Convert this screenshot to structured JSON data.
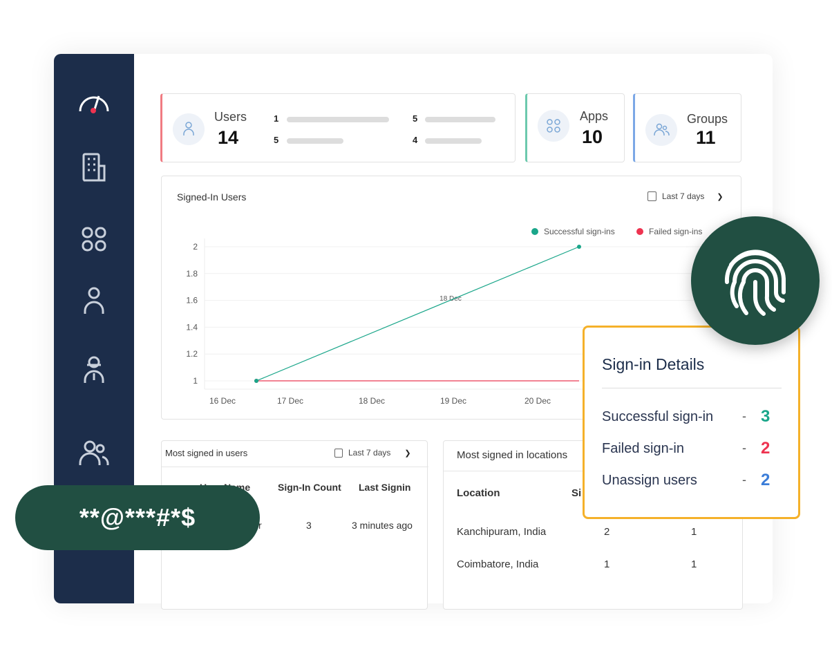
{
  "sidebar": {
    "items": [
      {
        "icon": "speedometer-icon"
      },
      {
        "icon": "building-icon"
      },
      {
        "icon": "apps-icon"
      },
      {
        "icon": "user-icon"
      },
      {
        "icon": "admin-user-icon"
      },
      {
        "icon": "groups-icon"
      }
    ]
  },
  "stats": {
    "users": {
      "label": "Users",
      "value": "14",
      "bars": [
        {
          "value": "1",
          "fill": 1.0
        },
        {
          "value": "5",
          "fill": 0.55
        },
        {
          "value": "5",
          "fill": 0.68
        },
        {
          "value": "4",
          "fill": 0.56
        }
      ],
      "accent": "#f07b82"
    },
    "apps": {
      "label": "Apps",
      "value": "10",
      "accent": "#6cc9ad"
    },
    "groups": {
      "label": "Groups",
      "value": "11",
      "accent": "#7ba7e6"
    }
  },
  "chart_panel": {
    "title": "Signed-In Users",
    "range": "Last 7 days",
    "tooltip": "18 Dec"
  },
  "chart_data": {
    "type": "line",
    "categories": [
      "16 Dec",
      "17 Dec",
      "18 Dec",
      "19 Dec",
      "20 Dec"
    ],
    "ylim": [
      1,
      2
    ],
    "yticks": [
      "1",
      "1.2",
      "1.4",
      "1.6",
      "1.8",
      "2"
    ],
    "grid": true,
    "legend": "top-right",
    "series": [
      {
        "name": "Successful sign-ins",
        "color": "#1aa68a",
        "points": [
          {
            "x": 16.5,
            "y": 1
          },
          {
            "x": 21.5,
            "y": 2
          }
        ]
      },
      {
        "name": "Failed sign-ins",
        "color": "#ee3350",
        "points": [
          {
            "x": 16.5,
            "y": 1
          },
          {
            "x": 21.5,
            "y": 1
          }
        ]
      }
    ]
  },
  "users_panel": {
    "title": "Most signed in users",
    "range": "Last 7 days",
    "headers": [
      "User Name",
      "Sign-In Count",
      "Last Signin"
    ],
    "rows": [
      [
        "r",
        "3",
        "3 minutes ago"
      ]
    ]
  },
  "locations_panel": {
    "title": "Most signed in locations",
    "headers": [
      "Location",
      "Si"
    ],
    "rows": [
      [
        "Kanchipuram, India",
        "2",
        "1"
      ],
      [
        "Coimbatore, India",
        "1",
        "1"
      ]
    ]
  },
  "password_badge": {
    "text": "**@***#*$"
  },
  "fingerprint": {
    "icon": "fingerprint-icon",
    "color": "#214f42"
  },
  "details": {
    "title": "Sign-in Details",
    "rows": [
      {
        "label": "Successful sign-in",
        "value": "3",
        "color": "#1aa68a"
      },
      {
        "label": "Failed sign-in",
        "value": "2",
        "color": "#ee3350"
      },
      {
        "label": "Unassign users",
        "value": "2",
        "color": "#3b7dd8"
      }
    ],
    "sep": "-"
  }
}
